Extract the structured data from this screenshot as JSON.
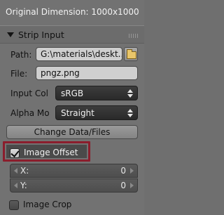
{
  "info": {
    "original_dimension": "Original Dimension: 1000x1000"
  },
  "panel": {
    "title": "Strip Input"
  },
  "path": {
    "label": "Path:",
    "value": "G:\\materials\\deskt..."
  },
  "file": {
    "label": "File:",
    "value": "pngz.png"
  },
  "input_color": {
    "label": "Input Col",
    "value": "sRGB"
  },
  "alpha_mode": {
    "label": "Alpha Mo",
    "value": "Straight"
  },
  "change_button": {
    "label": "Change Data/Files"
  },
  "image_offset": {
    "label": "Image Offset",
    "checked": true
  },
  "offset_x": {
    "label": "X:",
    "value": "0"
  },
  "offset_y": {
    "label": "Y:",
    "value": "0"
  },
  "image_crop": {
    "label": "Image Crop",
    "checked": false
  },
  "colors": {
    "highlight_border": "#8b1d2c"
  }
}
